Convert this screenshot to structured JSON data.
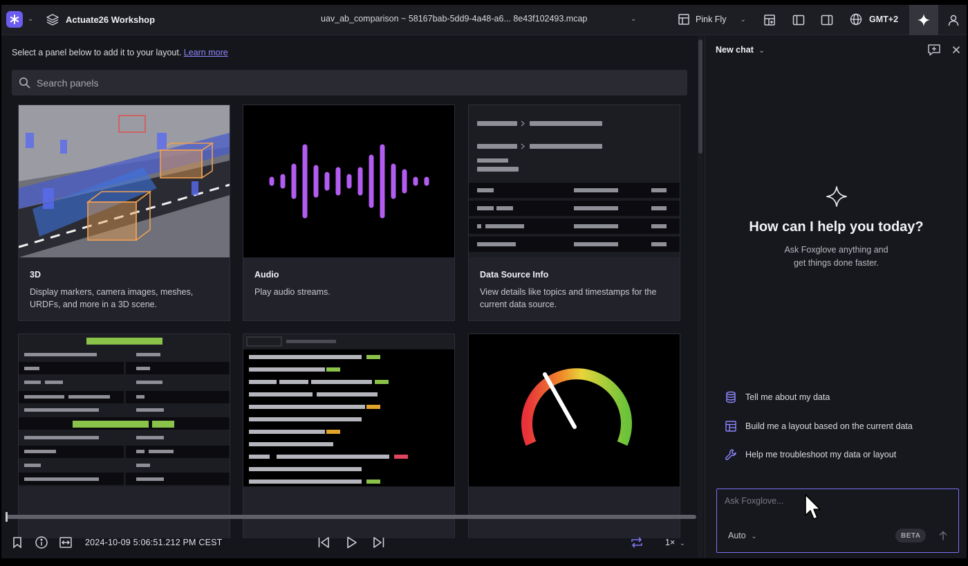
{
  "topbar": {
    "workspace": "Actuate26 Workshop",
    "file": "uav_ab_comparison ~ 58167bab-5dd9-4a48-a6... 8e43f102493.mcap",
    "layout_name": "Pink Fly",
    "timezone": "GMT+2"
  },
  "panels": {
    "hint": "Select a panel below to add it to your layout.",
    "learn_more": "Learn more",
    "search_placeholder": "Search panels",
    "cards": [
      {
        "title": "3D",
        "desc": "Display markers, camera images, meshes, URDFs, and more in a 3D scene."
      },
      {
        "title": "Audio",
        "desc": "Play audio streams."
      },
      {
        "title": "Data Source Info",
        "desc": "View details like topics and timestamps for the current data source."
      },
      {
        "title": "",
        "desc": ""
      },
      {
        "title": "",
        "desc": ""
      },
      {
        "title": "",
        "desc": ""
      }
    ]
  },
  "playback": {
    "timestamp": "2024-10-09 5:06:51.212 PM CEST",
    "speed": "1×"
  },
  "chat": {
    "title": "New chat",
    "heading": "How can I help you today?",
    "sub1": "Ask Foxglove anything and",
    "sub2": "get things done faster.",
    "suggestions": [
      "Tell me about my data",
      "Build me a layout based on the current data",
      "Help me troubleshoot my data or layout"
    ],
    "input_placeholder": "Ask Foxglove...",
    "mode": "Auto",
    "beta": "BETA"
  },
  "colors": {
    "accent": "#6d5cf0",
    "audio_wave": "#b25cf0",
    "green_bar": "#8bc34a",
    "amber_bar": "#e2a32b",
    "red_bar": "#e0455f"
  }
}
